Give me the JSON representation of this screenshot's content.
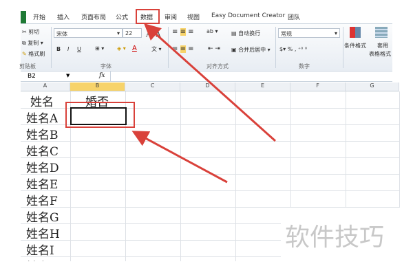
{
  "tabs": [
    "开始",
    "插入",
    "页面布局",
    "公式",
    "数据",
    "审阅",
    "视图",
    "Easy Document Creator",
    "团队"
  ],
  "clipboard": {
    "cut": "剪切",
    "copy": "复制 ▾",
    "painter": "格式刷",
    "label": "剪贴板"
  },
  "font": {
    "name": "宋体",
    "size": "22",
    "label": "字体",
    "bold": "B",
    "italic": "I",
    "underline": "U"
  },
  "alignment": {
    "wrap": "自动换行",
    "merge": "合并后居中 ▾",
    "label": "对齐方式"
  },
  "number": {
    "format": "常规",
    "percent": "%",
    "comma": ",",
    "label": "数字"
  },
  "styles": {
    "conditional": "条件格式",
    "table1": "套用",
    "table2": "表格格式"
  },
  "formula_bar": {
    "name_box": "B2",
    "fx": "fx",
    "value": ""
  },
  "columns": [
    "A",
    "B",
    "C",
    "D",
    "E",
    "F",
    "G"
  ],
  "cells": {
    "A1": "姓名",
    "B1": "婚否",
    "A": [
      "姓名A",
      "姓名B",
      "姓名C",
      "姓名D",
      "姓名E",
      "姓名F",
      "姓名G",
      "姓名H",
      "姓名I",
      "姓名J"
    ]
  },
  "watermark": "软件技巧",
  "accent": "#d9413a"
}
